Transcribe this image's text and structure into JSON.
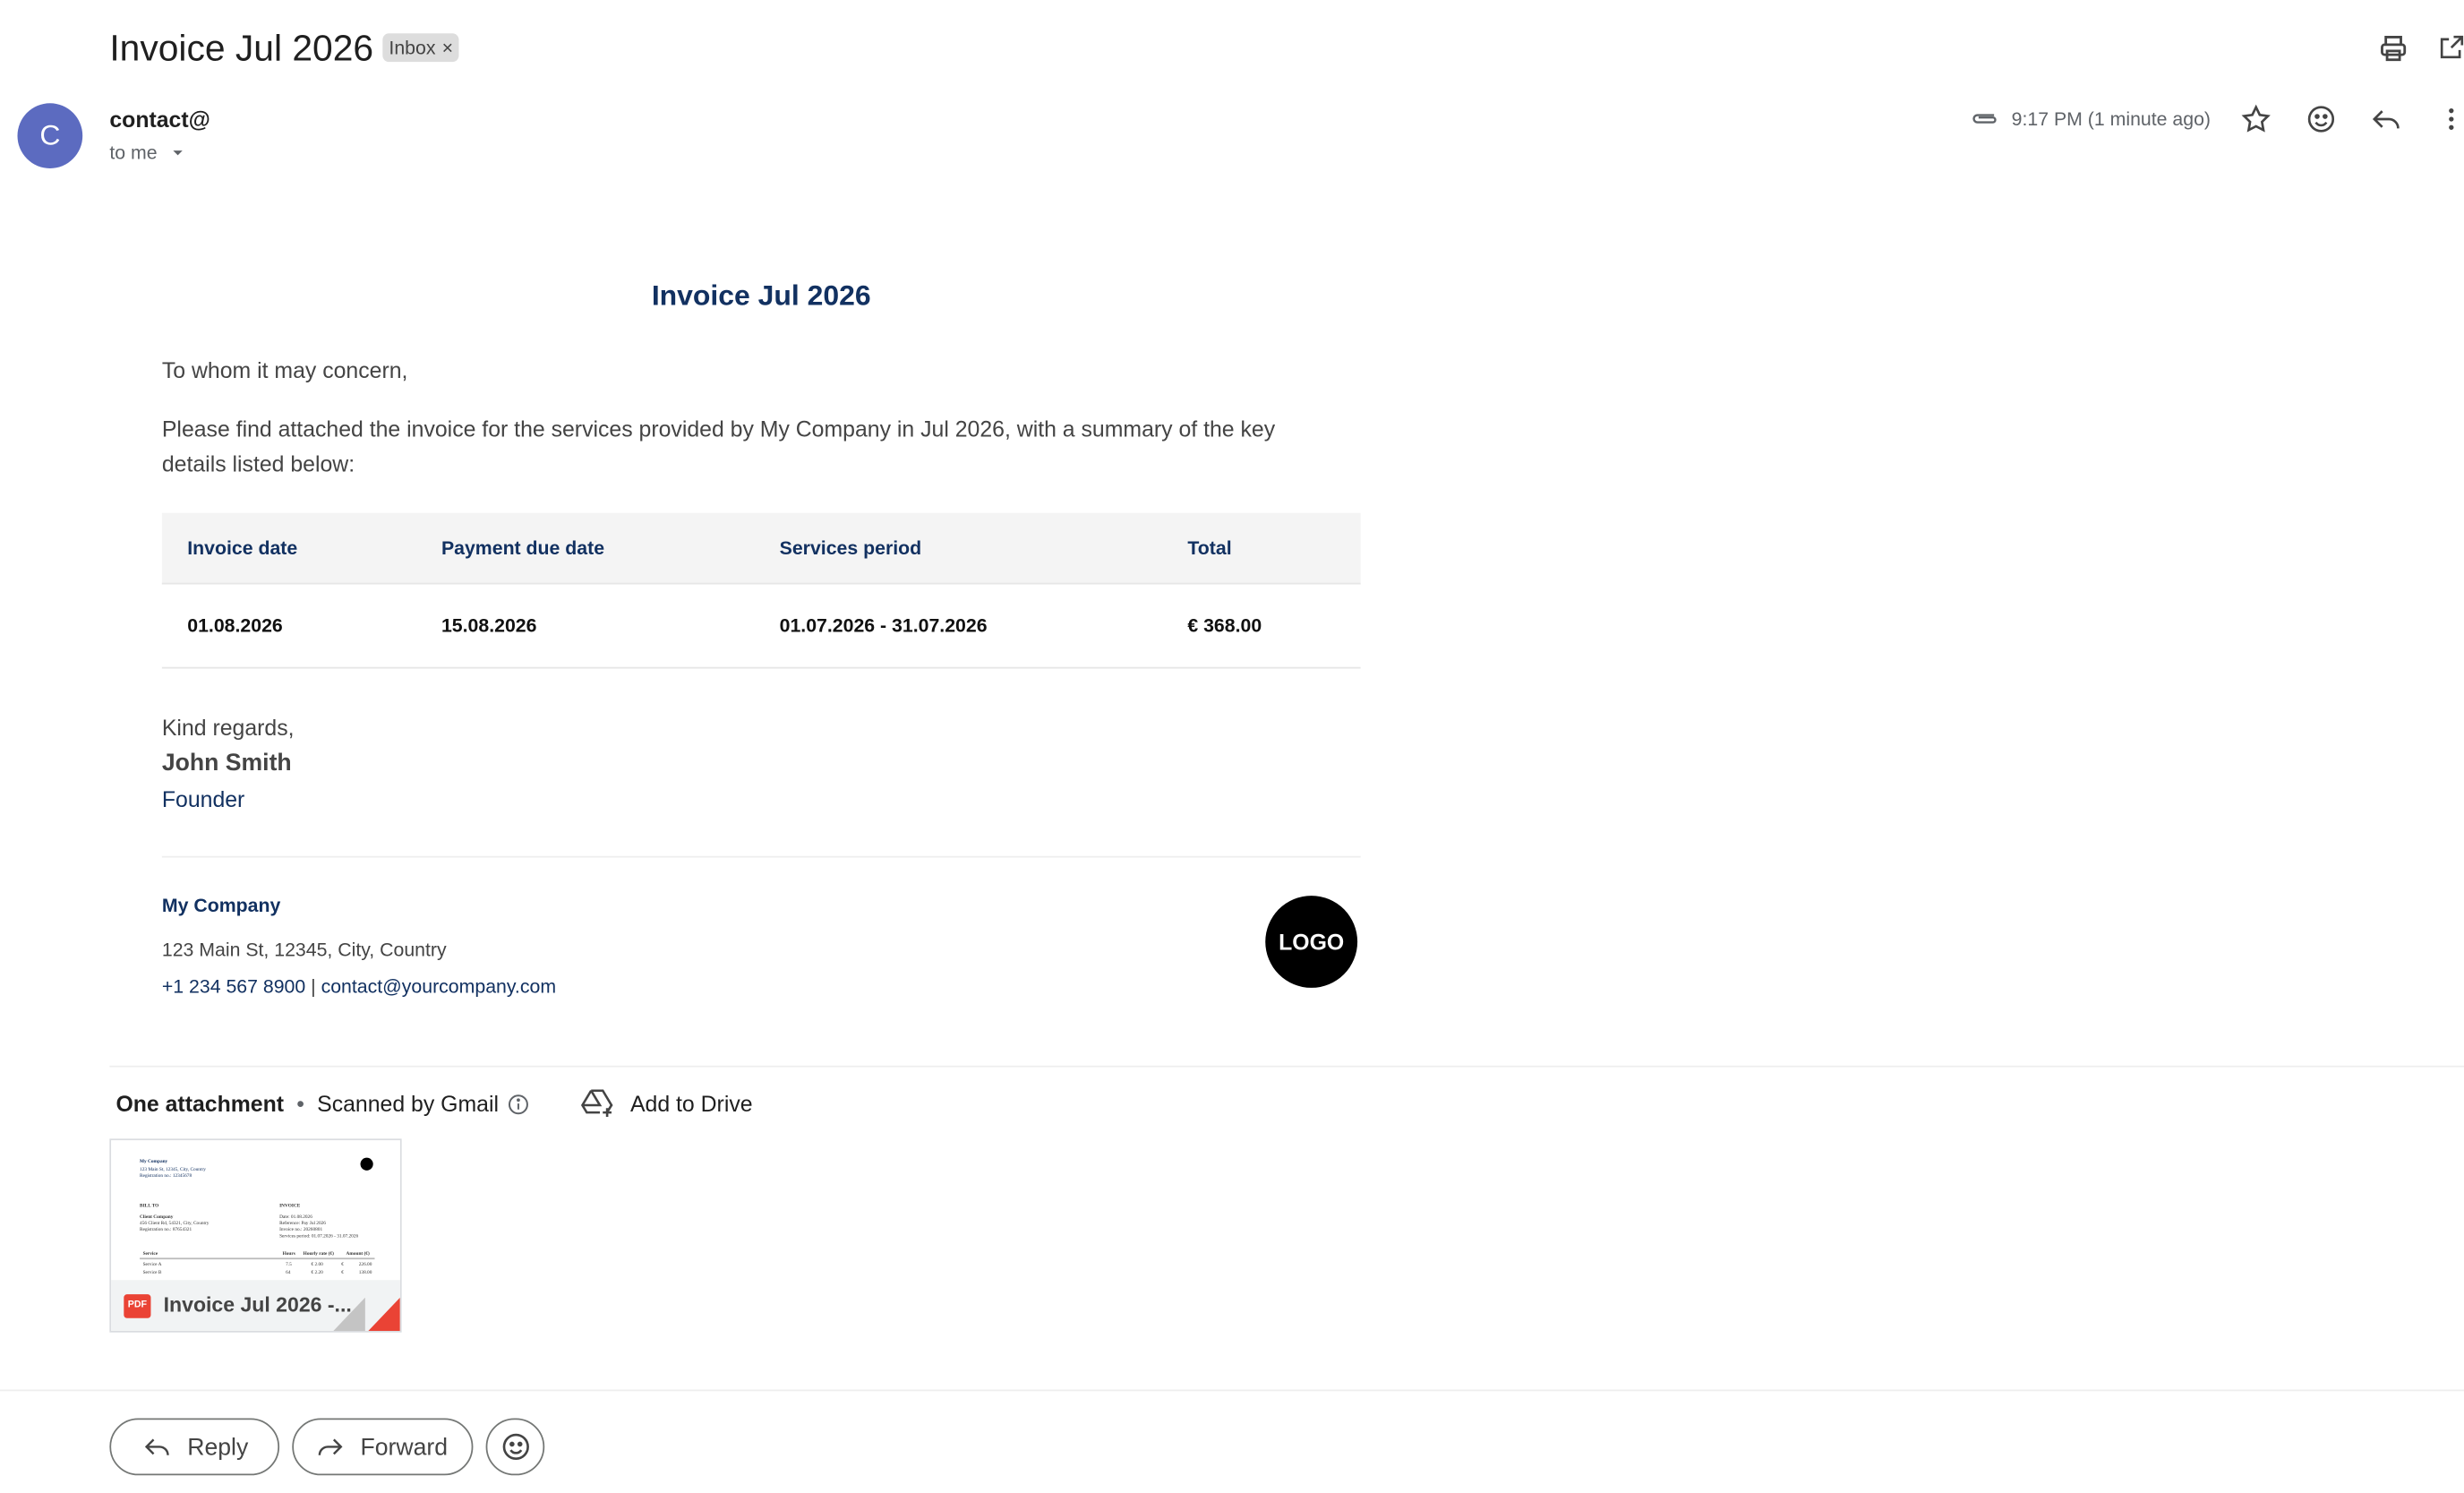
{
  "header": {
    "subject": "Invoice Jul 2026",
    "label_chip": "Inbox",
    "label_chip_remove": "×"
  },
  "sender": {
    "avatar_letter": "C",
    "avatar_color": "#5c6bc0",
    "name": "contact@",
    "recipient": "to me",
    "time": "9:17 PM (1 minute ago)"
  },
  "toolbar": {
    "icons": [
      "print-icon",
      "open-in-new-window-icon",
      "attachment-clip-icon",
      "star-icon",
      "emoji-react-icon",
      "reply-icon",
      "more-vert-icon"
    ]
  },
  "email": {
    "title": "Invoice Jul 2026",
    "greeting": "To whom it may concern,",
    "body": "Please find attached the invoice for the services provided by My Company in Jul 2026, with a summary of the key details listed below:",
    "table": {
      "headers": [
        "Invoice date",
        "Payment due date",
        "Services period",
        "Total"
      ],
      "row": [
        "01.08.2026",
        "15.08.2026",
        "01.07.2026 - 31.07.2026",
        "€ 368.00"
      ]
    },
    "closing": "Kind regards,",
    "signature_name": "John Smith",
    "signature_role": "Founder",
    "company": {
      "name": "My Company",
      "address": "123 Main St, 12345, City, Country",
      "phone": "+1 234 567 8900",
      "separator": " | ",
      "email": "contact@yourcompany.com",
      "logo_text": "LOGO"
    },
    "accent_color": "#123161"
  },
  "attachments": {
    "count_label": "One attachment",
    "bullet": "•",
    "scan_label": "Scanned by Gmail",
    "drive_label": "Add to Drive",
    "file": {
      "badge": "PDF",
      "name": "Invoice Jul 2026 -...",
      "preview": {
        "company": "My Company",
        "line1": "123 Main St, 12345, City, Country",
        "line2": "Registration no.: 12345678",
        "bill_to": "BILL TO",
        "client": "Client Company",
        "client_addr": "456 Client Rd, 54321, City, Country",
        "client_reg": "Registration no.: 87654321",
        "invoice": "INVOICE",
        "inv_date": "Date: 01.08.2026",
        "inv_ref": "Reference: Pay Jul 2026",
        "inv_no": "Invoice no.: 20260801",
        "inv_period": "Services period: 01.07.2026 - 31.07.2026",
        "col_service": "Service",
        "col_hours": "Hours",
        "col_rate": "Hourly rate (€)",
        "col_amount": "Amount (€)",
        "r1": [
          "Service A",
          "7.5",
          "€ 2.00",
          "€",
          "226.00"
        ],
        "r2": [
          "Service B",
          "64",
          "€ 2.20",
          "€",
          "138.00"
        ]
      }
    }
  },
  "actions": {
    "reply": "Reply",
    "forward": "Forward"
  }
}
